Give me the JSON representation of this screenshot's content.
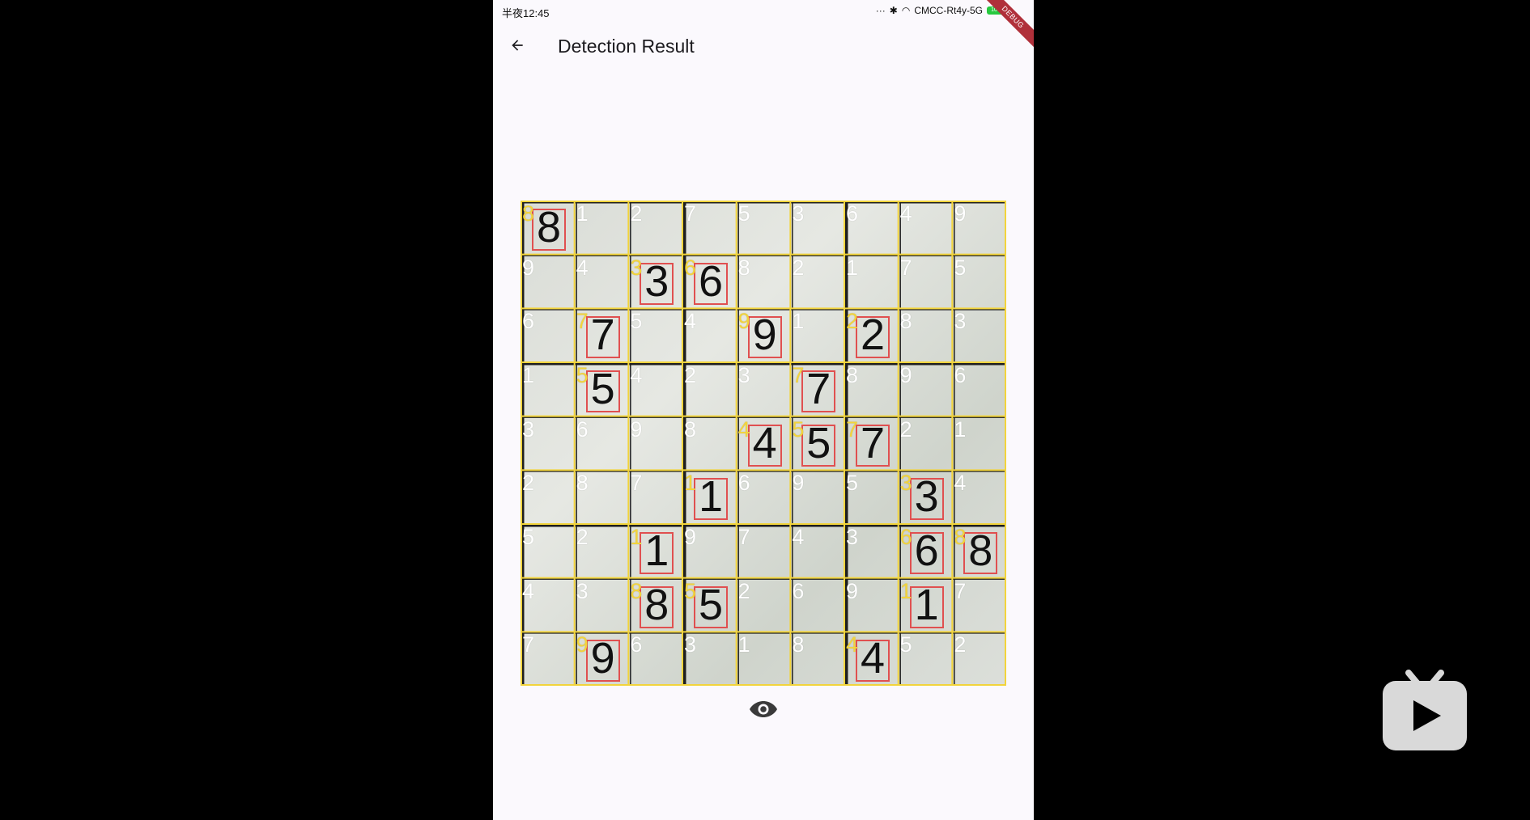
{
  "status_bar": {
    "time": "半夜12:45",
    "network": "CMCC-Rt4y-5G",
    "battery": "100",
    "debug_label": "DEBUG"
  },
  "app_bar": {
    "title": "Detection Result",
    "back_icon": "arrow-back-icon"
  },
  "grid": {
    "grid_line_color": "#f2d43c",
    "detected_number_color": "#f2d43c",
    "solved_number_color": "#ffffff",
    "box_color": "#e05050",
    "rows": [
      [
        8,
        1,
        2,
        7,
        5,
        3,
        6,
        4,
        9
      ],
      [
        9,
        4,
        3,
        6,
        8,
        2,
        1,
        7,
        5
      ],
      [
        6,
        7,
        5,
        4,
        9,
        1,
        2,
        8,
        3
      ],
      [
        1,
        5,
        4,
        2,
        3,
        7,
        8,
        9,
        6
      ],
      [
        3,
        6,
        9,
        8,
        4,
        5,
        7,
        2,
        1
      ],
      [
        2,
        8,
        7,
        1,
        6,
        9,
        5,
        3,
        4
      ],
      [
        5,
        2,
        1,
        9,
        7,
        4,
        3,
        6,
        8
      ],
      [
        4,
        3,
        8,
        5,
        2,
        6,
        9,
        1,
        7
      ],
      [
        7,
        9,
        6,
        3,
        1,
        8,
        4,
        5,
        2
      ]
    ],
    "detected": [
      [
        1,
        0,
        0,
        0,
        0,
        0,
        0,
        0,
        0
      ],
      [
        0,
        0,
        1,
        1,
        0,
        0,
        0,
        0,
        0
      ],
      [
        0,
        1,
        0,
        0,
        1,
        0,
        1,
        0,
        0
      ],
      [
        0,
        1,
        0,
        0,
        0,
        1,
        0,
        0,
        0
      ],
      [
        0,
        0,
        0,
        0,
        1,
        1,
        1,
        0,
        0
      ],
      [
        0,
        0,
        0,
        1,
        0,
        0,
        0,
        1,
        0
      ],
      [
        0,
        0,
        1,
        0,
        0,
        0,
        0,
        1,
        1
      ],
      [
        0,
        0,
        1,
        1,
        0,
        0,
        0,
        1,
        0
      ],
      [
        0,
        1,
        0,
        0,
        0,
        0,
        1,
        0,
        0
      ]
    ]
  },
  "toggle_icon": "eye-icon",
  "overlay_logo": "video-player-logo"
}
